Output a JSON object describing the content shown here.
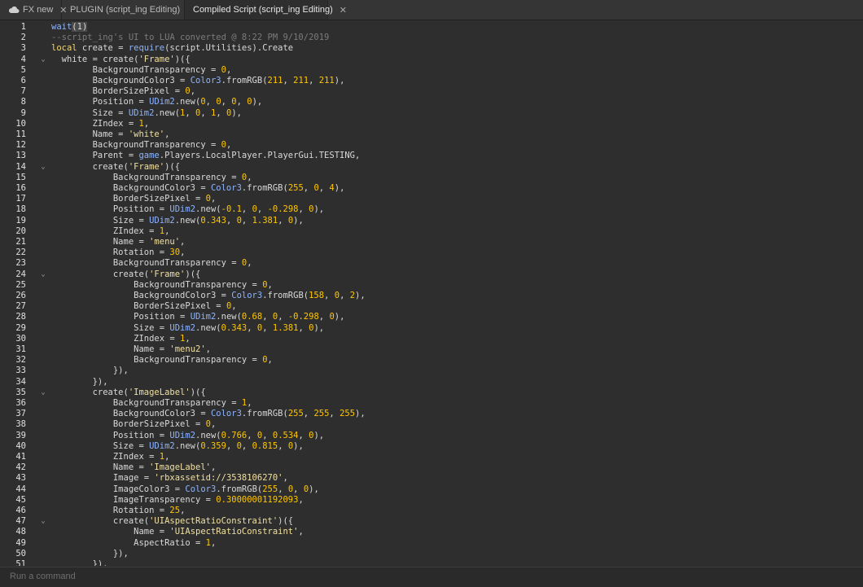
{
  "tabs": [
    {
      "label": "FX new",
      "icon": "cloud-icon",
      "active": false
    },
    {
      "label": "PLUGIN (script_ing Editing)",
      "icon": "",
      "active": false
    },
    {
      "label": "Compiled Script (script_ing Editing)",
      "icon": "",
      "active": true
    }
  ],
  "command_bar": {
    "placeholder": "Run a command"
  },
  "code_lines": [
    {
      "n": 1,
      "fold": false,
      "tokens": [
        [
          "fn",
          "wait"
        ],
        [
          "sel",
          "(1)"
        ]
      ]
    },
    {
      "n": 2,
      "fold": false,
      "tokens": [
        [
          "cmt",
          "--script_ing's UI to LUA converted @ 8:22 PM 9/10/2019"
        ]
      ]
    },
    {
      "n": 3,
      "fold": false,
      "tokens": [
        [
          "kw",
          "local"
        ],
        [
          "txt",
          " create = "
        ],
        [
          "fn",
          "require"
        ],
        [
          "txt",
          "(script.Utilities).Create"
        ]
      ]
    },
    {
      "n": 4,
      "fold": true,
      "tokens": [
        [
          "txt",
          "  white = create("
        ],
        [
          "str",
          "'Frame'"
        ],
        [
          "txt",
          ")({"
        ]
      ]
    },
    {
      "n": 5,
      "fold": false,
      "tokens": [
        [
          "txt",
          "        BackgroundTransparency = "
        ],
        [
          "num",
          "0"
        ],
        [
          "txt",
          ","
        ]
      ]
    },
    {
      "n": 6,
      "fold": false,
      "tokens": [
        [
          "txt",
          "        BackgroundColor3 = "
        ],
        [
          "fn",
          "Color3"
        ],
        [
          "txt",
          ".fromRGB("
        ],
        [
          "num",
          "211"
        ],
        [
          "txt",
          ", "
        ],
        [
          "num",
          "211"
        ],
        [
          "txt",
          ", "
        ],
        [
          "num",
          "211"
        ],
        [
          "txt",
          "),"
        ]
      ]
    },
    {
      "n": 7,
      "fold": false,
      "tokens": [
        [
          "txt",
          "        BorderSizePixel = "
        ],
        [
          "num",
          "0"
        ],
        [
          "txt",
          ","
        ]
      ]
    },
    {
      "n": 8,
      "fold": false,
      "tokens": [
        [
          "txt",
          "        Position = "
        ],
        [
          "fn",
          "UDim2"
        ],
        [
          "txt",
          ".new("
        ],
        [
          "num",
          "0"
        ],
        [
          "txt",
          ", "
        ],
        [
          "num",
          "0"
        ],
        [
          "txt",
          ", "
        ],
        [
          "num",
          "0"
        ],
        [
          "txt",
          ", "
        ],
        [
          "num",
          "0"
        ],
        [
          "txt",
          "),"
        ]
      ]
    },
    {
      "n": 9,
      "fold": false,
      "tokens": [
        [
          "txt",
          "        Size = "
        ],
        [
          "fn",
          "UDim2"
        ],
        [
          "txt",
          ".new("
        ],
        [
          "num",
          "1"
        ],
        [
          "txt",
          ", "
        ],
        [
          "num",
          "0"
        ],
        [
          "txt",
          ", "
        ],
        [
          "num",
          "1"
        ],
        [
          "txt",
          ", "
        ],
        [
          "num",
          "0"
        ],
        [
          "txt",
          "),"
        ]
      ]
    },
    {
      "n": 10,
      "fold": false,
      "tokens": [
        [
          "txt",
          "        ZIndex = "
        ],
        [
          "num",
          "1"
        ],
        [
          "txt",
          ","
        ]
      ]
    },
    {
      "n": 11,
      "fold": false,
      "tokens": [
        [
          "txt",
          "        Name = "
        ],
        [
          "str",
          "'white'"
        ],
        [
          "txt",
          ","
        ]
      ]
    },
    {
      "n": 12,
      "fold": false,
      "tokens": [
        [
          "txt",
          "        BackgroundTransparency = "
        ],
        [
          "num",
          "0"
        ],
        [
          "txt",
          ","
        ]
      ]
    },
    {
      "n": 13,
      "fold": false,
      "tokens": [
        [
          "txt",
          "        Parent = "
        ],
        [
          "fn",
          "game"
        ],
        [
          "txt",
          ".Players.LocalPlayer.PlayerGui.TESTING,"
        ]
      ]
    },
    {
      "n": 14,
      "fold": true,
      "tokens": [
        [
          "txt",
          "        create("
        ],
        [
          "str",
          "'Frame'"
        ],
        [
          "txt",
          ")({"
        ]
      ]
    },
    {
      "n": 15,
      "fold": false,
      "tokens": [
        [
          "txt",
          "            BackgroundTransparency = "
        ],
        [
          "num",
          "0"
        ],
        [
          "txt",
          ","
        ]
      ]
    },
    {
      "n": 16,
      "fold": false,
      "tokens": [
        [
          "txt",
          "            BackgroundColor3 = "
        ],
        [
          "fn",
          "Color3"
        ],
        [
          "txt",
          ".fromRGB("
        ],
        [
          "num",
          "255"
        ],
        [
          "txt",
          ", "
        ],
        [
          "num",
          "0"
        ],
        [
          "txt",
          ", "
        ],
        [
          "num",
          "4"
        ],
        [
          "txt",
          "),"
        ]
      ]
    },
    {
      "n": 17,
      "fold": false,
      "tokens": [
        [
          "txt",
          "            BorderSizePixel = "
        ],
        [
          "num",
          "0"
        ],
        [
          "txt",
          ","
        ]
      ]
    },
    {
      "n": 18,
      "fold": false,
      "tokens": [
        [
          "txt",
          "            Position = "
        ],
        [
          "fn",
          "UDim2"
        ],
        [
          "txt",
          ".new("
        ],
        [
          "num",
          "-0.1"
        ],
        [
          "txt",
          ", "
        ],
        [
          "num",
          "0"
        ],
        [
          "txt",
          ", "
        ],
        [
          "num",
          "-0.298"
        ],
        [
          "txt",
          ", "
        ],
        [
          "num",
          "0"
        ],
        [
          "txt",
          "),"
        ]
      ]
    },
    {
      "n": 19,
      "fold": false,
      "tokens": [
        [
          "txt",
          "            Size = "
        ],
        [
          "fn",
          "UDim2"
        ],
        [
          "txt",
          ".new("
        ],
        [
          "num",
          "0.343"
        ],
        [
          "txt",
          ", "
        ],
        [
          "num",
          "0"
        ],
        [
          "txt",
          ", "
        ],
        [
          "num",
          "1.381"
        ],
        [
          "txt",
          ", "
        ],
        [
          "num",
          "0"
        ],
        [
          "txt",
          "),"
        ]
      ]
    },
    {
      "n": 20,
      "fold": false,
      "tokens": [
        [
          "txt",
          "            ZIndex = "
        ],
        [
          "num",
          "1"
        ],
        [
          "txt",
          ","
        ]
      ]
    },
    {
      "n": 21,
      "fold": false,
      "tokens": [
        [
          "txt",
          "            Name = "
        ],
        [
          "str",
          "'menu'"
        ],
        [
          "txt",
          ","
        ]
      ]
    },
    {
      "n": 22,
      "fold": false,
      "tokens": [
        [
          "txt",
          "            Rotation = "
        ],
        [
          "num",
          "30"
        ],
        [
          "txt",
          ","
        ]
      ]
    },
    {
      "n": 23,
      "fold": false,
      "tokens": [
        [
          "txt",
          "            BackgroundTransparency = "
        ],
        [
          "num",
          "0"
        ],
        [
          "txt",
          ","
        ]
      ]
    },
    {
      "n": 24,
      "fold": true,
      "tokens": [
        [
          "txt",
          "            create("
        ],
        [
          "str",
          "'Frame'"
        ],
        [
          "txt",
          ")({"
        ]
      ]
    },
    {
      "n": 25,
      "fold": false,
      "tokens": [
        [
          "txt",
          "                BackgroundTransparency = "
        ],
        [
          "num",
          "0"
        ],
        [
          "txt",
          ","
        ]
      ]
    },
    {
      "n": 26,
      "fold": false,
      "tokens": [
        [
          "txt",
          "                BackgroundColor3 = "
        ],
        [
          "fn",
          "Color3"
        ],
        [
          "txt",
          ".fromRGB("
        ],
        [
          "num",
          "158"
        ],
        [
          "txt",
          ", "
        ],
        [
          "num",
          "0"
        ],
        [
          "txt",
          ", "
        ],
        [
          "num",
          "2"
        ],
        [
          "txt",
          "),"
        ]
      ]
    },
    {
      "n": 27,
      "fold": false,
      "tokens": [
        [
          "txt",
          "                BorderSizePixel = "
        ],
        [
          "num",
          "0"
        ],
        [
          "txt",
          ","
        ]
      ]
    },
    {
      "n": 28,
      "fold": false,
      "tokens": [
        [
          "txt",
          "                Position = "
        ],
        [
          "fn",
          "UDim2"
        ],
        [
          "txt",
          ".new("
        ],
        [
          "num",
          "0.68"
        ],
        [
          "txt",
          ", "
        ],
        [
          "num",
          "0"
        ],
        [
          "txt",
          ", "
        ],
        [
          "num",
          "-0.298"
        ],
        [
          "txt",
          ", "
        ],
        [
          "num",
          "0"
        ],
        [
          "txt",
          "),"
        ]
      ]
    },
    {
      "n": 29,
      "fold": false,
      "tokens": [
        [
          "txt",
          "                Size = "
        ],
        [
          "fn",
          "UDim2"
        ],
        [
          "txt",
          ".new("
        ],
        [
          "num",
          "0.343"
        ],
        [
          "txt",
          ", "
        ],
        [
          "num",
          "0"
        ],
        [
          "txt",
          ", "
        ],
        [
          "num",
          "1.381"
        ],
        [
          "txt",
          ", "
        ],
        [
          "num",
          "0"
        ],
        [
          "txt",
          "),"
        ]
      ]
    },
    {
      "n": 30,
      "fold": false,
      "tokens": [
        [
          "txt",
          "                ZIndex = "
        ],
        [
          "num",
          "1"
        ],
        [
          "txt",
          ","
        ]
      ]
    },
    {
      "n": 31,
      "fold": false,
      "tokens": [
        [
          "txt",
          "                Name = "
        ],
        [
          "str",
          "'menu2'"
        ],
        [
          "txt",
          ","
        ]
      ]
    },
    {
      "n": 32,
      "fold": false,
      "tokens": [
        [
          "txt",
          "                BackgroundTransparency = "
        ],
        [
          "num",
          "0"
        ],
        [
          "txt",
          ","
        ]
      ]
    },
    {
      "n": 33,
      "fold": false,
      "tokens": [
        [
          "txt",
          "            }),"
        ]
      ]
    },
    {
      "n": 34,
      "fold": false,
      "tokens": [
        [
          "txt",
          "        }),"
        ]
      ]
    },
    {
      "n": 35,
      "fold": true,
      "tokens": [
        [
          "txt",
          "        create("
        ],
        [
          "str",
          "'ImageLabel'"
        ],
        [
          "txt",
          ")({"
        ]
      ]
    },
    {
      "n": 36,
      "fold": false,
      "tokens": [
        [
          "txt",
          "            BackgroundTransparency = "
        ],
        [
          "num",
          "1"
        ],
        [
          "txt",
          ","
        ]
      ]
    },
    {
      "n": 37,
      "fold": false,
      "tokens": [
        [
          "txt",
          "            BackgroundColor3 = "
        ],
        [
          "fn",
          "Color3"
        ],
        [
          "txt",
          ".fromRGB("
        ],
        [
          "num",
          "255"
        ],
        [
          "txt",
          ", "
        ],
        [
          "num",
          "255"
        ],
        [
          "txt",
          ", "
        ],
        [
          "num",
          "255"
        ],
        [
          "txt",
          "),"
        ]
      ]
    },
    {
      "n": 38,
      "fold": false,
      "tokens": [
        [
          "txt",
          "            BorderSizePixel = "
        ],
        [
          "num",
          "0"
        ],
        [
          "txt",
          ","
        ]
      ]
    },
    {
      "n": 39,
      "fold": false,
      "tokens": [
        [
          "txt",
          "            Position = "
        ],
        [
          "fn",
          "UDim2"
        ],
        [
          "txt",
          ".new("
        ],
        [
          "num",
          "0.766"
        ],
        [
          "txt",
          ", "
        ],
        [
          "num",
          "0"
        ],
        [
          "txt",
          ", "
        ],
        [
          "num",
          "0.534"
        ],
        [
          "txt",
          ", "
        ],
        [
          "num",
          "0"
        ],
        [
          "txt",
          "),"
        ]
      ]
    },
    {
      "n": 40,
      "fold": false,
      "tokens": [
        [
          "txt",
          "            Size = "
        ],
        [
          "fn",
          "UDim2"
        ],
        [
          "txt",
          ".new("
        ],
        [
          "num",
          "0.359"
        ],
        [
          "txt",
          ", "
        ],
        [
          "num",
          "0"
        ],
        [
          "txt",
          ", "
        ],
        [
          "num",
          "0.815"
        ],
        [
          "txt",
          ", "
        ],
        [
          "num",
          "0"
        ],
        [
          "txt",
          "),"
        ]
      ]
    },
    {
      "n": 41,
      "fold": false,
      "tokens": [
        [
          "txt",
          "            ZIndex = "
        ],
        [
          "num",
          "1"
        ],
        [
          "txt",
          ","
        ]
      ]
    },
    {
      "n": 42,
      "fold": false,
      "tokens": [
        [
          "txt",
          "            Name = "
        ],
        [
          "str",
          "'ImageLabel'"
        ],
        [
          "txt",
          ","
        ]
      ]
    },
    {
      "n": 43,
      "fold": false,
      "tokens": [
        [
          "txt",
          "            Image = "
        ],
        [
          "str",
          "'rbxassetid://3538106270'"
        ],
        [
          "txt",
          ","
        ]
      ]
    },
    {
      "n": 44,
      "fold": false,
      "tokens": [
        [
          "txt",
          "            ImageColor3 = "
        ],
        [
          "fn",
          "Color3"
        ],
        [
          "txt",
          ".fromRGB("
        ],
        [
          "num",
          "255"
        ],
        [
          "txt",
          ", "
        ],
        [
          "num",
          "0"
        ],
        [
          "txt",
          ", "
        ],
        [
          "num",
          "0"
        ],
        [
          "txt",
          "),"
        ]
      ]
    },
    {
      "n": 45,
      "fold": false,
      "tokens": [
        [
          "txt",
          "            ImageTransparency = "
        ],
        [
          "num",
          "0.30000001192093"
        ],
        [
          "txt",
          ","
        ]
      ]
    },
    {
      "n": 46,
      "fold": false,
      "tokens": [
        [
          "txt",
          "            Rotation = "
        ],
        [
          "num",
          "25"
        ],
        [
          "txt",
          ","
        ]
      ]
    },
    {
      "n": 47,
      "fold": true,
      "tokens": [
        [
          "txt",
          "            create("
        ],
        [
          "str",
          "'UIAspectRatioConstraint'"
        ],
        [
          "txt",
          ")({"
        ]
      ]
    },
    {
      "n": 48,
      "fold": false,
      "tokens": [
        [
          "txt",
          "                Name = "
        ],
        [
          "str",
          "'UIAspectRatioConstraint'"
        ],
        [
          "txt",
          ","
        ]
      ]
    },
    {
      "n": 49,
      "fold": false,
      "tokens": [
        [
          "txt",
          "                AspectRatio = "
        ],
        [
          "num",
          "1"
        ],
        [
          "txt",
          ","
        ]
      ]
    },
    {
      "n": 50,
      "fold": false,
      "tokens": [
        [
          "txt",
          "            }),"
        ]
      ]
    },
    {
      "n": 51,
      "fold": false,
      "tokens": [
        [
          "txt",
          "        }),"
        ]
      ]
    }
  ]
}
